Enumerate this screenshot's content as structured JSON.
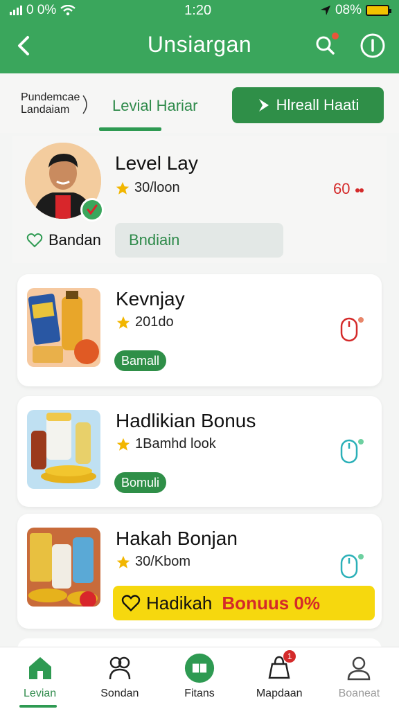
{
  "status_bar": {
    "signal_text": "0 0%",
    "time": "1:20",
    "battery_text": "08%"
  },
  "header": {
    "title": "Unsiargan",
    "back_icon": "chevron-left-icon",
    "search_icon": "search-icon",
    "info_icon": "info-icon"
  },
  "tabs": {
    "side_label_line1": "Pundemcae",
    "side_label_line2": "Landaiam",
    "active_tab": "Levial Hariar",
    "cta_label": "Hlreall Haati"
  },
  "profile": {
    "name": "Level Lay",
    "subtitle": "30/loon",
    "score": "60",
    "favorite_label": "Bandan",
    "chip_label": "Bndiain"
  },
  "products": [
    {
      "title": "Kevnjay",
      "subtitle": "201do",
      "badge": "Bamall"
    },
    {
      "title": "Hadlikian Bonus",
      "subtitle": "1Bamhd look",
      "badge": "Bomuli"
    },
    {
      "title": "Hakah Bonjan",
      "subtitle": "30/Kbom",
      "promo_text": "Hadikah",
      "promo_highlight": "Bonuus 0%"
    }
  ],
  "bottom_nav": [
    {
      "label": "Levian",
      "icon": "home-icon"
    },
    {
      "label": "Sondan",
      "icon": "group-icon"
    },
    {
      "label": "Fitans",
      "icon": "cards-icon"
    },
    {
      "label": "Mapdaan",
      "icon": "bag-icon",
      "badge": "1"
    },
    {
      "label": "Boaneat",
      "icon": "user-icon"
    }
  ],
  "colors": {
    "primary_green": "#3aa65c",
    "dark_green": "#2f8f48",
    "promo_yellow": "#f6d80e",
    "accent_red": "#d42a2a"
  }
}
